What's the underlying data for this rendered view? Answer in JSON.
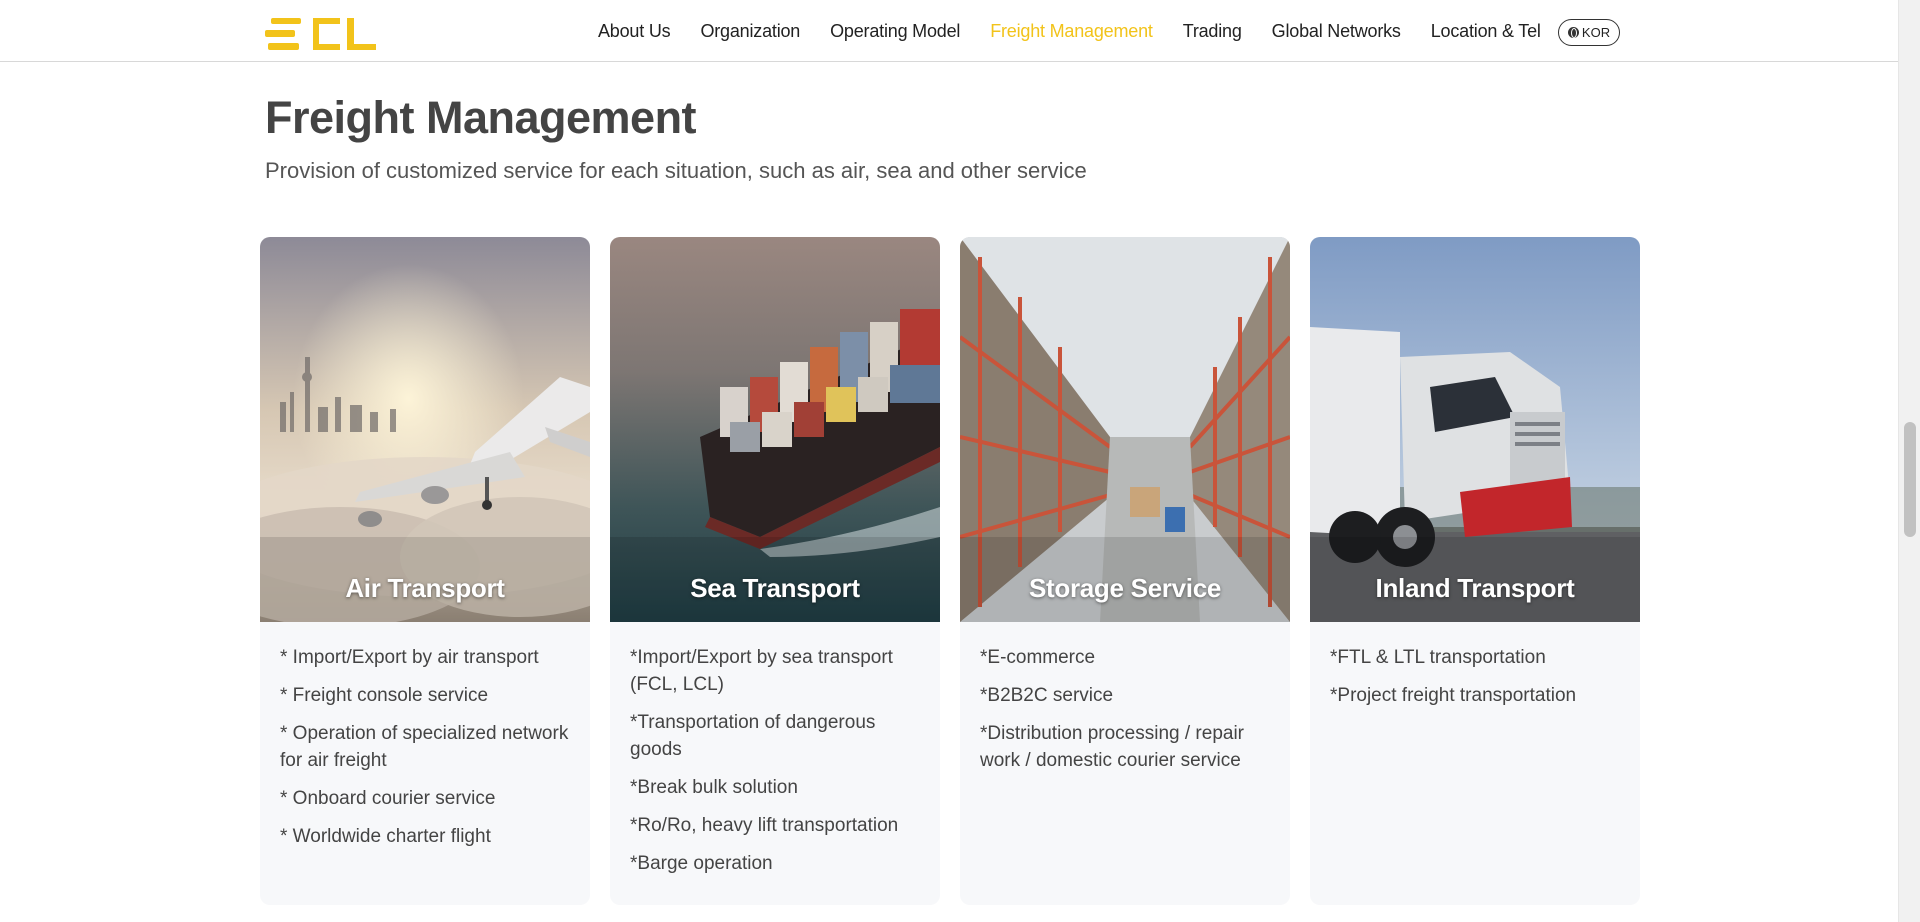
{
  "header": {
    "logo_text": "ECL",
    "nav": [
      {
        "label": "About Us",
        "active": false
      },
      {
        "label": "Organization",
        "active": false
      },
      {
        "label": "Operating Model",
        "active": false
      },
      {
        "label": "Freight Management",
        "active": true
      },
      {
        "label": "Trading",
        "active": false
      },
      {
        "label": "Global Networks",
        "active": false
      },
      {
        "label": "Location & Tel",
        "active": false
      }
    ],
    "lang_label": "KOR",
    "lang_icon": "globe-icon"
  },
  "main": {
    "title": "Freight Management",
    "subtitle": "Provision of customized service for each situation, such as air, sea and other service"
  },
  "cards": [
    {
      "title": "Air Transport",
      "image": "airplane-photo",
      "items": [
        "* Import/Export by air transport",
        "* Freight console service",
        "* Operation of specialized network for air freight",
        "* Onboard courier service",
        "* Worldwide charter flight"
      ]
    },
    {
      "title": "Sea Transport",
      "image": "container-ship-photo",
      "items": [
        "*Import/Export by sea transport (FCL, LCL)",
        "*Transportation of dangerous goods",
        "*Break bulk solution",
        "*Ro/Ro, heavy lift transportation",
        "*Barge operation"
      ]
    },
    {
      "title": "Storage Service",
      "image": "warehouse-photo",
      "items": [
        "*E-commerce",
        "*B2B2C service",
        "*Distribution processing / repair work / domestic courier service"
      ]
    },
    {
      "title": "Inland Transport",
      "image": "truck-photo",
      "items": [
        "*FTL & LTL transportation",
        "*Project freight transportation"
      ]
    }
  ],
  "colors": {
    "accent": "#f2c31a",
    "text": "#444444",
    "card_bg": "#f7f8fa"
  }
}
